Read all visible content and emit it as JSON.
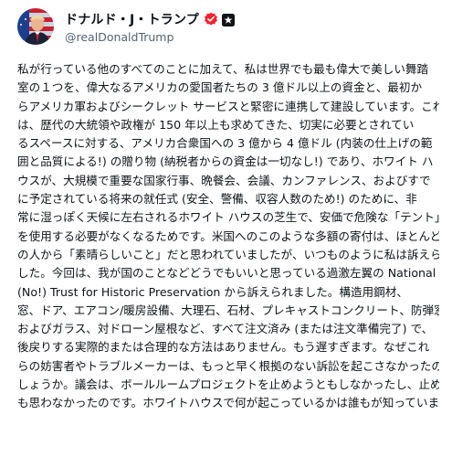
{
  "author": {
    "display_name": "ドナルド・J・トランプ",
    "handle": "@realDonaldTrump",
    "verified": true,
    "verified_badge_color": "#f4212e",
    "affiliation_badge": "government-affiliation-icon"
  },
  "post": {
    "lines": [
      "私が行っている他のすべてのことに加えて、私は世界でも最も偉大で美しい舞踏",
      "室の１つを、偉大なるアメリカの愛国者たちの 3 億ドル以上の資金と、最初か",
      "らアメリカ軍およびシークレット サービスと緊密に連携して建設しています。これ",
      "は、歴代の大統領や政権が 150 年以上も求めてきた、切実に必要とされてい",
      "るスペースに対する、アメリカ合衆国への 3 億から 4 億ドル (内装の仕上げの範",
      "囲と品質による!) の贈り物 (納税者からの資金は一切なし!) であり、ホワイト ハ",
      "ウスが、大規模で重要な国家行事、晩餐会、会議、カンファレンス、およびすで",
      "に予定されている将来の就任式 (安全、警備、収容人数のため!) のために、非",
      "常に湿っぽく天候に左右されるホワイト ハウスの芝生で、安価で危険な「テント」",
      "を使用する必要がなくなるためです。米国へのこのような多額の寄付は、ほとんど",
      "の人から「素晴らしいこと」だと思われていましたが、いつものように私は訴えられま",
      "した。今回は、我が国のことなどどうでもいいと思っている過激左翼の National",
      "(No!) Trust for Historic Preservation から訴えられました。構造用鋼材、",
      "窓、ドア、エアコン/暖房設備、大理石、石材、プレキャストコンクリート、防弾窓",
      "およびガラス、対ドローン屋根など、すべて注文済み (または注文準備完了) で、",
      "後戻りする実際的または合理的な方法はありません。もう遅すぎます。なぜこれ",
      "らの妨害者やトラブルメーカーは、もっと早く根拠のない訴訟を起こさなかったので",
      "しょうか。議会は、ボールルームプロジェクトを止めようともしなかったし、止めたいと",
      "も思わなかったのです。ホワイトハウスで何が起こっているかは誰もが知っていまし"
    ]
  },
  "colors": {
    "text": "#0f1419",
    "secondary_text": "#536471",
    "background": "#ffffff"
  }
}
